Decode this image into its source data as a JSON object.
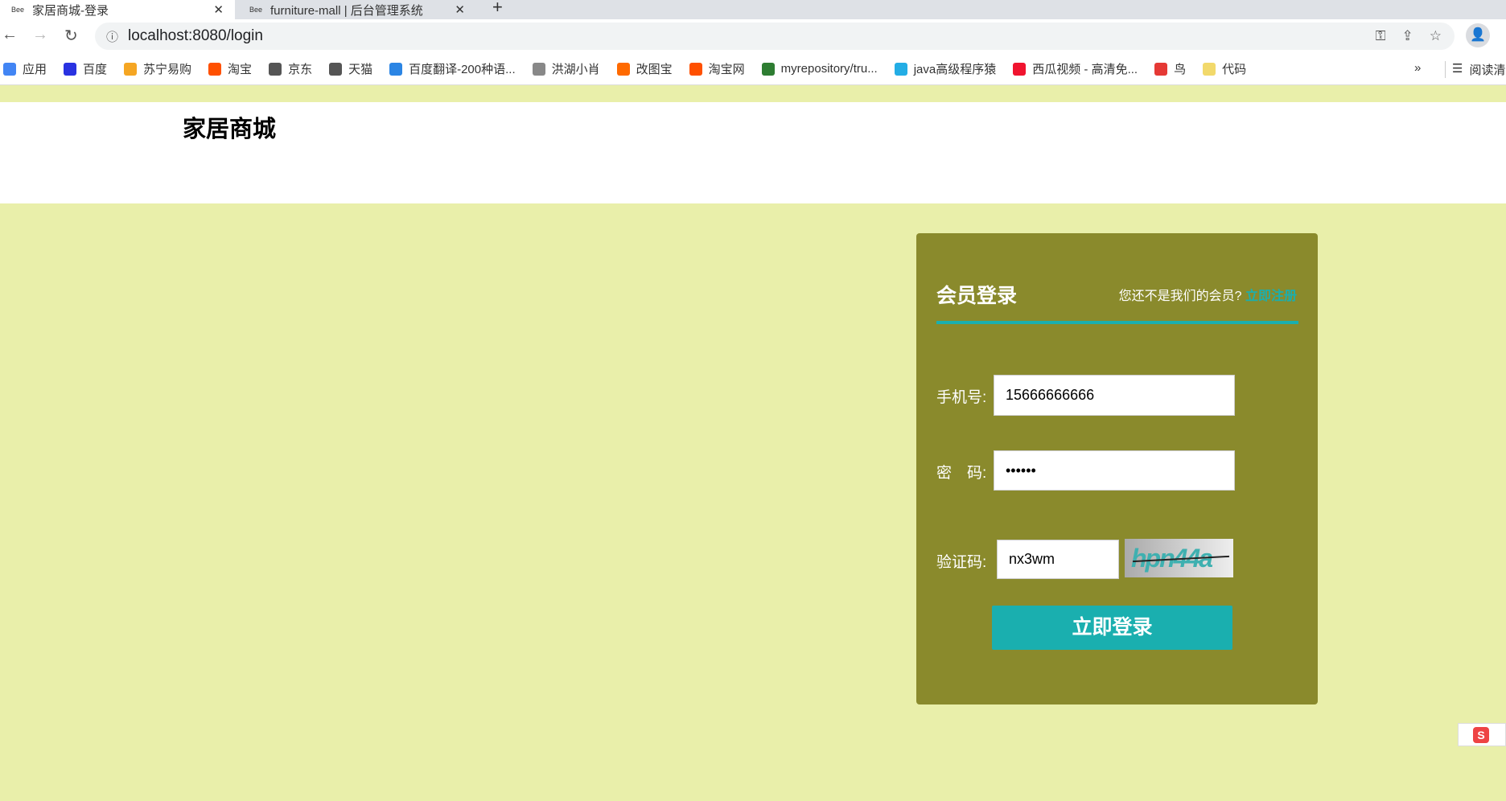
{
  "browser": {
    "tabs": [
      {
        "label": "家居商城-登录",
        "favicon": "bee-icon",
        "active": true
      },
      {
        "label": "furniture-mall | 后台管理系统",
        "favicon": "bee-icon",
        "active": false
      }
    ],
    "url": "localhost:8080/login",
    "bookmarks": [
      {
        "label": "应用",
        "icon": "apps-icon",
        "color": "#4285f4"
      },
      {
        "label": "百度",
        "icon": "baidu-icon",
        "color": "#2932e1"
      },
      {
        "label": "苏宁易购",
        "icon": "suning-icon",
        "color": "#f5a623"
      },
      {
        "label": "淘宝",
        "icon": "taobao-icon",
        "color": "#ff5000"
      },
      {
        "label": "京东",
        "icon": "globe-icon",
        "color": "#555555"
      },
      {
        "label": "天猫",
        "icon": "globe-icon",
        "color": "#555555"
      },
      {
        "label": "百度翻译-200种语...",
        "icon": "translate-icon",
        "color": "#2b85e4"
      },
      {
        "label": "洪湖小肖",
        "icon": "bird-icon",
        "color": "#888888"
      },
      {
        "label": "改图宝",
        "icon": "gaitubao-icon",
        "color": "#ff6a00"
      },
      {
        "label": "淘宝网",
        "icon": "taobao-icon",
        "color": "#ff5000"
      },
      {
        "label": "myrepository/tru...",
        "icon": "repo-icon",
        "color": "#2e7d32"
      },
      {
        "label": "java高级程序猿",
        "icon": "bilibili-icon",
        "color": "#23ade5"
      },
      {
        "label": "西瓜视频 - 高清免...",
        "icon": "xigua-icon",
        "color": "#f0142f"
      },
      {
        "label": "鸟",
        "icon": "bird-icon",
        "color": "#e53935"
      },
      {
        "label": "代码",
        "icon": "code-icon",
        "color": "#f2d96b"
      }
    ],
    "more": "»",
    "reading_list": "阅读清"
  },
  "site": {
    "logo": "家居商城"
  },
  "login": {
    "title": "会员登录",
    "register_prompt": "您还不是我们的会员?",
    "register_link": "立即注册",
    "phone_label": "手机号:",
    "phone_value": "15666666666",
    "password_label": "密　码:",
    "password_value": "••••••",
    "captcha_label": "验证码:",
    "captcha_value": "nx3wm",
    "captcha_image_text": "hpn44a",
    "submit": "立即登录"
  },
  "colors": {
    "background": "#e9efaa",
    "panel": "#8a8a2c",
    "accent": "#1aafaf"
  }
}
